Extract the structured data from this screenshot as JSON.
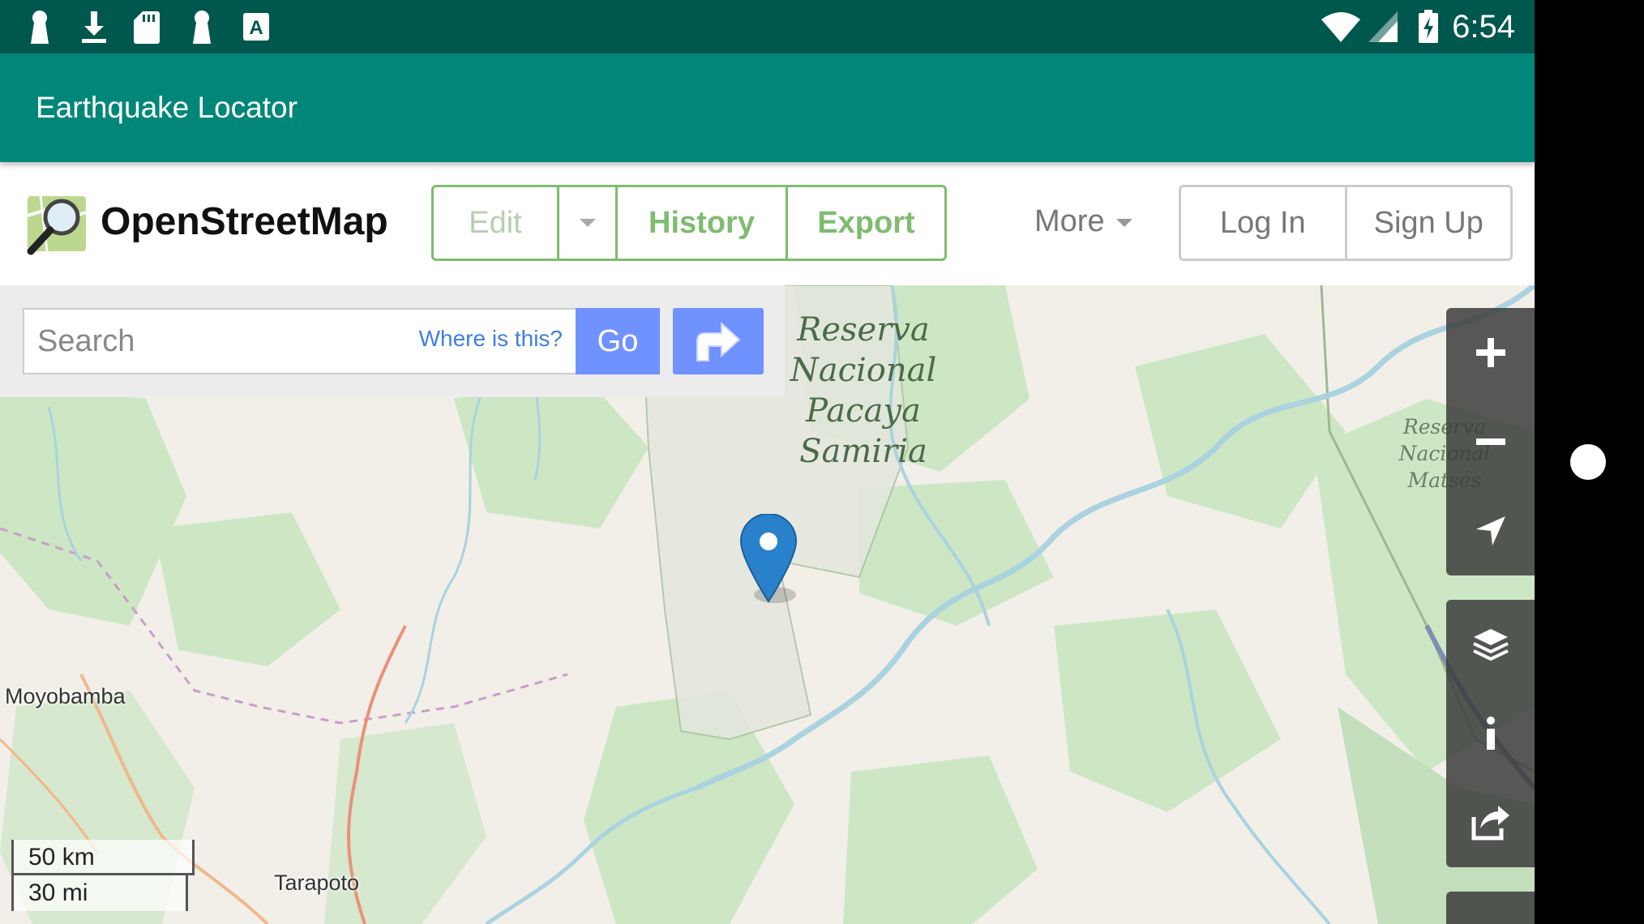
{
  "status_bar": {
    "time": "6:54",
    "left_icons": [
      "keyhole-icon",
      "download-icon",
      "sd-card-icon",
      "keyhole-icon",
      "font-a-icon"
    ],
    "right_icons": [
      "wifi-icon",
      "signal-icon",
      "battery-charging-icon"
    ]
  },
  "app_bar": {
    "title": "Earthquake Locator"
  },
  "osm": {
    "brand": "OpenStreetMap",
    "nav": {
      "edit": "Edit",
      "history": "History",
      "export": "Export",
      "more": "More"
    },
    "auth": {
      "login": "Log In",
      "signup": "Sign Up"
    }
  },
  "search": {
    "placeholder": "Search",
    "where_link": "Where is this?",
    "go": "Go"
  },
  "map": {
    "labels": {
      "reserve_main": [
        "Reserva",
        "Nacional",
        "Pacaya",
        "Samiria"
      ],
      "reserve_side": [
        "Reserva",
        "Nacional",
        "Matsés"
      ],
      "city_moyobamba": "Moyobamba",
      "city_tarapoto": "Tarapoto"
    },
    "scale": {
      "km": "50 km",
      "mi": "30 mi"
    },
    "colors": {
      "land": "#f2efe9",
      "forest": "#cde7c4",
      "reserve": "#e4e7df",
      "water": "#aad3df",
      "marker": "#2a81cb"
    }
  },
  "controls": {
    "top": [
      "zoom-in-icon",
      "zoom-out-icon",
      "locate-icon"
    ],
    "bottom": [
      "layers-icon",
      "info-icon",
      "share-icon"
    ]
  }
}
